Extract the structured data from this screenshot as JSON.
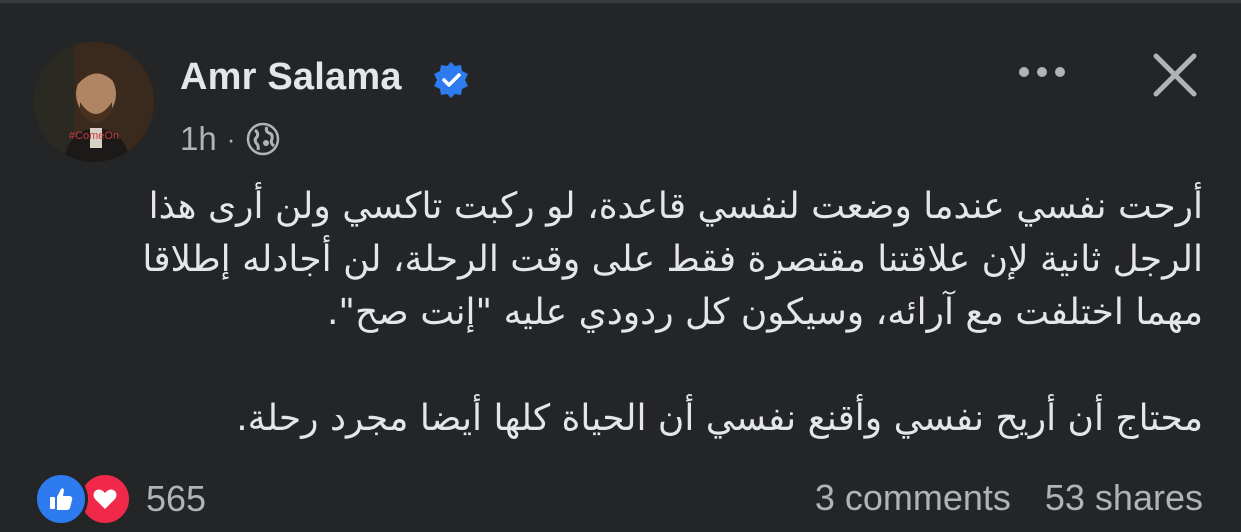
{
  "post": {
    "author": "Amr Salama",
    "verified": true,
    "time": "1h",
    "separator": "·",
    "audience_icon": "globe-icon",
    "avatar_text": "#ComeOn",
    "paragraphs": [
      [
        "أرحت نفسي عندما وضعت لنفسي قاعدة، لو ركبت تاكسي ولن أرى هذا",
        "الرجل ثانية لإن علاقتنا مقتصرة فقط على وقت الرحلة، لن أجادله إطلاقا",
        "مهما اختلفت مع آرائه، وسيكون كل ردودي عليه \"إنت صح\"."
      ],
      [
        "محتاج أن أريح نفسي وأقنع نفسي أن الحياة كلها أيضا مجرد رحلة."
      ]
    ]
  },
  "footer": {
    "reaction_count": "565",
    "comments": "3 comments",
    "shares": "53 shares"
  },
  "colors": {
    "background": "#242526",
    "text": "#e4e6eb",
    "muted": "#b0b3b8",
    "like": "#2e7bf0",
    "love": "#f0284a",
    "verified": "#2e7bf0"
  }
}
